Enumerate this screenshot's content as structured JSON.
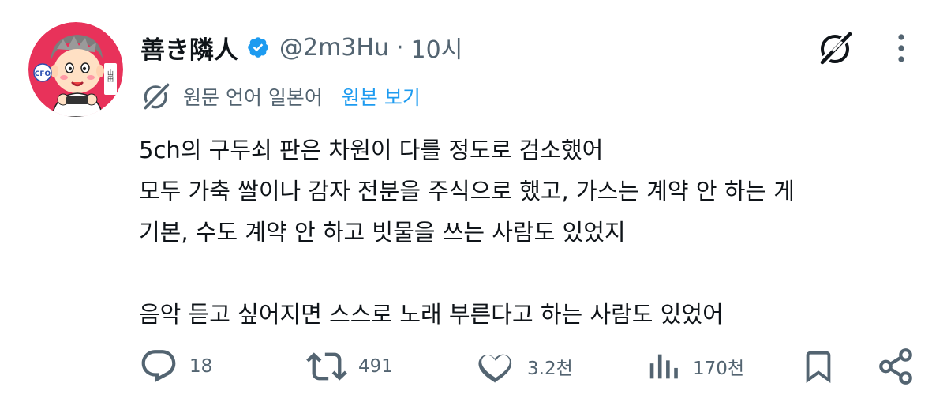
{
  "tweet": {
    "display_name": "善き隣人",
    "handle": "@2m3Hu",
    "separator": "·",
    "time": "10시",
    "verified": true,
    "avatar_alt": "avatar",
    "avatar_text": {
      "badge": "CFO",
      "name_tag": "山田"
    }
  },
  "translation": {
    "label": "원문 언어 일본어",
    "show_original": "원본 보기"
  },
  "body": {
    "lines": [
      "5ch의 구두쇠 판은 차원이 다를 정도로 검소했어",
      "모두 가축 쌀이나 감자 전분을 주식으로 했고, 가스는 계약 안 하는 게",
      "기본, 수도 계약 안 하고 빗물을 쓰는 사람도 있었지",
      "",
      "음악 듣고 싶어지면 스스로 노래 부른다고 하는 사람도 있었어"
    ]
  },
  "actions": {
    "reply_count": "18",
    "retweet_count": "491",
    "like_count": "3.2천",
    "views_count": "170천"
  },
  "colors": {
    "text_primary": "#0f1419",
    "text_secondary": "#536471",
    "accent": "#1d9bf0",
    "avatar_bg": "#e8325a"
  },
  "icons": {
    "verified": "verified-badge-icon",
    "grok": "grok-icon",
    "more": "more-dots-icon",
    "translate": "grok-translate-icon",
    "reply": "reply-icon",
    "retweet": "retweet-icon",
    "like": "heart-icon",
    "views": "views-icon",
    "bookmark": "bookmark-icon",
    "share": "share-icon"
  }
}
